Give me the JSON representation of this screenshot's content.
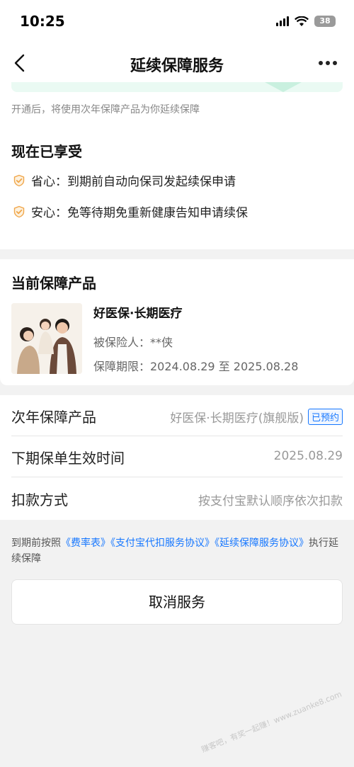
{
  "status_bar": {
    "time": "10:25",
    "battery": "38"
  },
  "nav": {
    "title": "延续保障服务"
  },
  "intro": {
    "text": "开通后，将使用次年保障产品为你延续保障"
  },
  "enjoy": {
    "title": "现在已享受",
    "items": [
      {
        "label": "省心：到期前自动向保司发起续保申请"
      },
      {
        "label": "安心：免等待期免重新健康告知申请续保"
      }
    ]
  },
  "current_product": {
    "section_title": "当前保障产品",
    "name": "好医保·长期医疗",
    "insured": "被保险人：**侠",
    "period": "保障期限：2024.08.29 至 2025.08.28"
  },
  "info_rows": [
    {
      "label": "次年保障产品",
      "value": "好医保·长期医疗(旗舰版)",
      "badge": "已预约"
    },
    {
      "label": "下期保单生效时间",
      "value": "2025.08.29"
    },
    {
      "label": "扣款方式",
      "value": "按支付宝默认顺序依次扣款"
    }
  ],
  "agreement": {
    "prefix": "到期前按照",
    "link1": "《费率表》",
    "link2": "《支付宝代扣服务协议》",
    "link3": "《延续保障服务协议》",
    "suffix": "执行延续保障"
  },
  "cancel_button": {
    "label": "取消服务"
  },
  "watermark": {
    "text": "赚客吧，有奖一起赚！www.zuanke8.com"
  },
  "colors": {
    "accent": "#1677ff",
    "check": "#f0a64a",
    "mint": "#eafaf3"
  }
}
